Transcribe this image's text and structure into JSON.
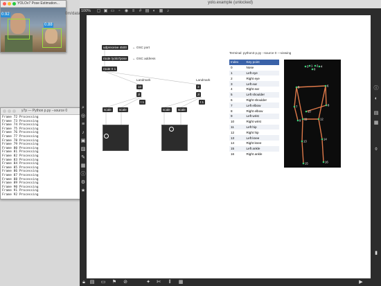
{
  "desktop": {
    "window_title": "yolo.example (unlocked)"
  },
  "yolo_window": {
    "title": "YOLOv7 Pose Estimation...",
    "detections": [
      {
        "label": "0.92"
      },
      {
        "label": "0.88"
      }
    ],
    "url_fragment": "0m/datase"
  },
  "terminal": {
    "title": "y7p — Python p.py --source 0",
    "lines": [
      "Frame 72 Processing",
      "Frame 73 Processing",
      "Frame 74 Processing",
      "Frame 75 Processing",
      "Frame 76 Processing",
      "Frame 77 Processing",
      "Frame 78 Processing",
      "Frame 79 Processing",
      "Frame 80 Processing",
      "Frame 81 Processing",
      "Frame 82 Processing",
      "Frame 83 Processing",
      "Frame 84 Processing",
      "Frame 85 Processing",
      "Frame 86 Processing",
      "Frame 87 Processing",
      "Frame 88 Processing",
      "Frame 89 Processing",
      "Frame 90 Processing",
      "Frame 91 Processing",
      "Frame 92 Processing"
    ]
  },
  "max": {
    "zoom": "100%",
    "objects": {
      "udpreceive": "udpreceive 4500",
      "udpreceive_cmt": "← OSC port",
      "route": "route /yolo7pose",
      "route_cmt": "← OSC address",
      "unpack": "route 0 1",
      "landmark_left": "Landmark",
      "landmark_right": "Landmark",
      "num_left": "10",
      "num_right": "3",
      "zl_left": "zl",
      "zl_right": "zl",
      "tl_left": "t 1",
      "tl_right": "t 1",
      "scale_left_a": "scale",
      "scale_left_b": "scale",
      "scale_right_a": "scale",
      "scale_right_b": "scale"
    },
    "terminal_cmt": "Terminal: python3 p.py --source 0 —viewing",
    "table": {
      "headers": [
        "Index",
        "Key point"
      ],
      "rows": [
        {
          "index": "0",
          "name": "Nose"
        },
        {
          "index": "1",
          "name": "Left eye"
        },
        {
          "index": "2",
          "name": "Right eye"
        },
        {
          "index": "3",
          "name": "Left ear"
        },
        {
          "index": "4",
          "name": "Right ear"
        },
        {
          "index": "5",
          "name": "Left shoulder"
        },
        {
          "index": "6",
          "name": "Right shoulder"
        },
        {
          "index": "7",
          "name": "Left elbow"
        },
        {
          "index": "8",
          "name": "Right elbow"
        },
        {
          "index": "9",
          "name": "Left wrist"
        },
        {
          "index": "10",
          "name": "Right wrist"
        },
        {
          "index": "11",
          "name": "Left hip"
        },
        {
          "index": "12",
          "name": "Right hip"
        },
        {
          "index": "13",
          "name": "Left knee"
        },
        {
          "index": "14",
          "name": "Right knee"
        },
        {
          "index": "15",
          "name": "Left ankle"
        },
        {
          "index": "16",
          "name": "Right ankle"
        }
      ]
    },
    "skeleton_labels": [
      "1",
      "2",
      "3",
      "4",
      "0",
      "5",
      "6",
      "7",
      "8",
      "9",
      "10",
      "11",
      "12",
      "13",
      "14",
      "15",
      "16"
    ]
  }
}
